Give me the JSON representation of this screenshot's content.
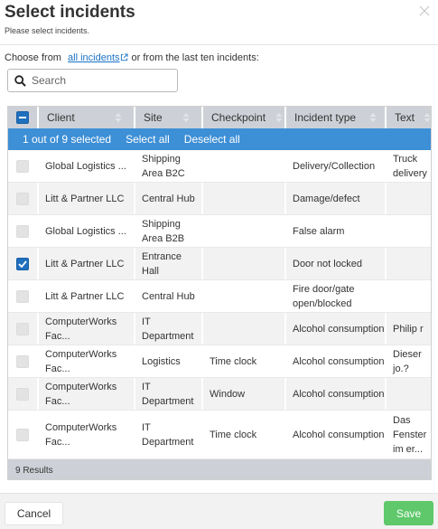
{
  "dialog": {
    "title": "Select incidents",
    "subtitle": "Please select incidents."
  },
  "choose": {
    "prefix": "Choose from",
    "link": "all incidents",
    "suffix": "or from the last ten incidents:"
  },
  "search": {
    "placeholder": "Search",
    "value": ""
  },
  "table": {
    "columns": [
      "Client",
      "Site",
      "Checkpoint",
      "Incident type",
      "Text"
    ],
    "selection": {
      "count_text": "1 out of 9 selected",
      "select_all": "Select all",
      "deselect_all": "Deselect all"
    },
    "rows": [
      {
        "checked": false,
        "client": "Global Logistics ...",
        "site": "Shipping Area B2C",
        "checkpoint": "",
        "incident_type": "Delivery/Collection",
        "text": "Truck delivery"
      },
      {
        "checked": false,
        "client": "Litt & Partner LLC",
        "site": "Central Hub",
        "checkpoint": "",
        "incident_type": "Damage/defect",
        "text": ""
      },
      {
        "checked": false,
        "client": "Global Logistics ...",
        "site": "Shipping Area B2B",
        "checkpoint": "",
        "incident_type": "False alarm",
        "text": ""
      },
      {
        "checked": true,
        "client": "Litt & Partner LLC",
        "site": "Entrance Hall",
        "checkpoint": "",
        "incident_type": "Door not locked",
        "text": ""
      },
      {
        "checked": false,
        "client": "Litt & Partner LLC",
        "site": "Central Hub",
        "checkpoint": "",
        "incident_type": "Fire door/gate open/blocked",
        "text": ""
      },
      {
        "checked": false,
        "client": "ComputerWorks Fac...",
        "site": "IT Department",
        "checkpoint": "",
        "incident_type": "Alcohol consumption",
        "text": "Philip r"
      },
      {
        "checked": false,
        "client": "ComputerWorks Fac...",
        "site": "Logistics",
        "checkpoint": "Time clock",
        "incident_type": "Alcohol consumption",
        "text": "Dieser jo.?"
      },
      {
        "checked": false,
        "client": "ComputerWorks Fac...",
        "site": "IT Department",
        "checkpoint": "Window",
        "incident_type": "Alcohol consumption",
        "text": ""
      },
      {
        "checked": false,
        "client": "ComputerWorks Fac...",
        "site": "IT Department",
        "checkpoint": "Time clock",
        "incident_type": "Alcohol consumption",
        "text": "Das Fenster im er..."
      }
    ],
    "results": "9 Results"
  },
  "footer": {
    "cancel_label": "Cancel",
    "save_label": "Save"
  },
  "colors": {
    "accent": "#3d8fd6",
    "checkbox_checked": "#1f6fbf",
    "save": "#5ec86a",
    "link": "#1a73c6",
    "header_bg": "#cdd1d7"
  },
  "icons": {
    "close": "close-icon",
    "external_link": "external-link-icon",
    "search": "search-icon",
    "sort": "sort-icon",
    "checkbox": "checkbox"
  }
}
